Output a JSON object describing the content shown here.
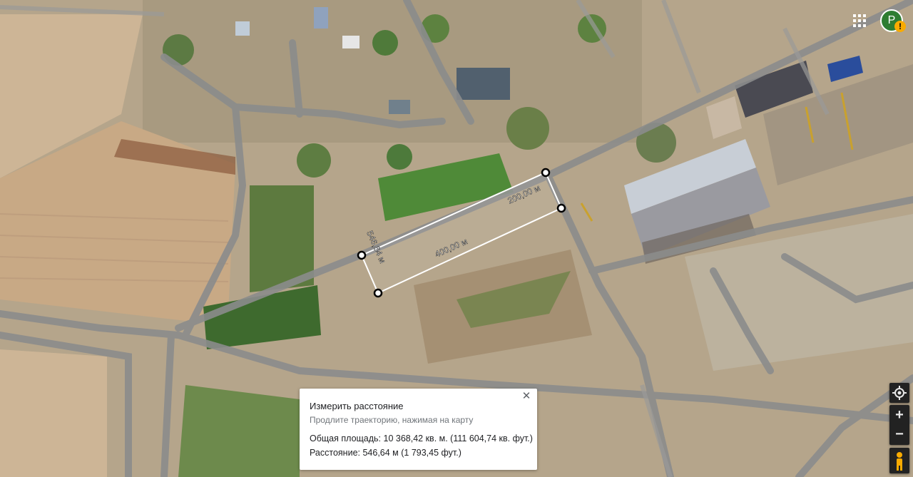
{
  "map": {
    "measurement_labels": {
      "right_side": "200,00 м",
      "bottom_side": "400,00 м",
      "left_side": "546,64 м"
    }
  },
  "panel": {
    "title": "Измерить расстояние",
    "hint": "Продлите траекторию, нажимая на карту",
    "total_area": "Общая площадь: 10 368,42 кв. м. (111 604,74 кв. фут.)",
    "distance": "Расстояние: 546,64 м (1 793,45 фут.)",
    "close_icon": "close-icon"
  },
  "header": {
    "apps_icon": "apps-grid-icon",
    "avatar_letter": "P",
    "avatar_color": "#2e7d32",
    "warning_badge": "!"
  },
  "controls": {
    "location_icon": "my-location-icon",
    "zoom_in_label": "+",
    "zoom_out_label": "−",
    "pegman_icon": "pegman-icon"
  },
  "colors": {
    "panel_bg": "#ffffff",
    "measure_line": "#ffffff",
    "controls_bg": "#222222",
    "pegman": "#f9ab00"
  }
}
